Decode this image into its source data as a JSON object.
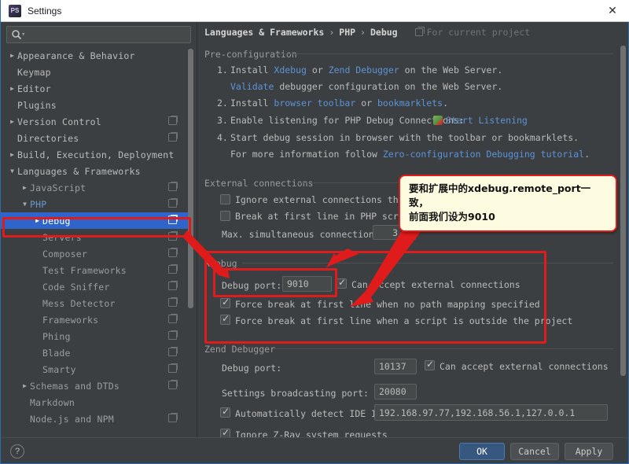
{
  "window": {
    "title": "Settings",
    "app_icon": "phpstorm-icon",
    "close_label": "✕"
  },
  "sidebar": {
    "search": {
      "placeholder": "",
      "value": "",
      "icon": "search-icon"
    },
    "items": [
      {
        "label": "Appearance & Behavior",
        "indent": 0,
        "arrow": "right",
        "copy": false,
        "selected": false,
        "style": "normal"
      },
      {
        "label": "Keymap",
        "indent": 0,
        "arrow": "none",
        "copy": false,
        "selected": false,
        "style": "normal"
      },
      {
        "label": "Editor",
        "indent": 0,
        "arrow": "right",
        "copy": false,
        "selected": false,
        "style": "normal"
      },
      {
        "label": "Plugins",
        "indent": 0,
        "arrow": "none",
        "copy": false,
        "selected": false,
        "style": "normal"
      },
      {
        "label": "Version Control",
        "indent": 0,
        "arrow": "right",
        "copy": true,
        "selected": false,
        "style": "normal"
      },
      {
        "label": "Directories",
        "indent": 0,
        "arrow": "none",
        "copy": true,
        "selected": false,
        "style": "normal"
      },
      {
        "label": "Build, Execution, Deployment",
        "indent": 0,
        "arrow": "right",
        "copy": false,
        "selected": false,
        "style": "normal"
      },
      {
        "label": "Languages & Frameworks",
        "indent": 0,
        "arrow": "down",
        "copy": false,
        "selected": false,
        "style": "normal"
      },
      {
        "label": "JavaScript",
        "indent": 1,
        "arrow": "right",
        "copy": true,
        "selected": false,
        "style": "dim"
      },
      {
        "label": "PHP",
        "indent": 1,
        "arrow": "down",
        "copy": true,
        "selected": false,
        "style": "blue"
      },
      {
        "label": "Debug",
        "indent": 2,
        "arrow": "right",
        "copy": true,
        "selected": true,
        "style": "normal"
      },
      {
        "label": "Servers",
        "indent": 2,
        "arrow": "none",
        "copy": true,
        "selected": false,
        "style": "dim"
      },
      {
        "label": "Composer",
        "indent": 2,
        "arrow": "none",
        "copy": true,
        "selected": false,
        "style": "dim"
      },
      {
        "label": "Test Frameworks",
        "indent": 2,
        "arrow": "none",
        "copy": true,
        "selected": false,
        "style": "dim"
      },
      {
        "label": "Code Sniffer",
        "indent": 2,
        "arrow": "none",
        "copy": true,
        "selected": false,
        "style": "dim"
      },
      {
        "label": "Mess Detector",
        "indent": 2,
        "arrow": "none",
        "copy": true,
        "selected": false,
        "style": "dim"
      },
      {
        "label": "Frameworks",
        "indent": 2,
        "arrow": "none",
        "copy": true,
        "selected": false,
        "style": "dim"
      },
      {
        "label": "Phing",
        "indent": 2,
        "arrow": "none",
        "copy": true,
        "selected": false,
        "style": "dim"
      },
      {
        "label": "Blade",
        "indent": 2,
        "arrow": "none",
        "copy": true,
        "selected": false,
        "style": "dim"
      },
      {
        "label": "Smarty",
        "indent": 2,
        "arrow": "none",
        "copy": true,
        "selected": false,
        "style": "dim"
      },
      {
        "label": "Schemas and DTDs",
        "indent": 1,
        "arrow": "right",
        "copy": true,
        "selected": false,
        "style": "dim"
      },
      {
        "label": "Markdown",
        "indent": 1,
        "arrow": "none",
        "copy": false,
        "selected": false,
        "style": "dim"
      },
      {
        "label": "Node.js and NPM",
        "indent": 1,
        "arrow": "none",
        "copy": true,
        "selected": false,
        "style": "dim"
      }
    ]
  },
  "main": {
    "breadcrumb": {
      "part1": "Languages & Frameworks",
      "sep1": "›",
      "part2": "PHP",
      "sep2": "›",
      "part3": "Debug",
      "project_scope": "For current project"
    },
    "pre_configuration": {
      "title": "Pre-configuration",
      "step1_num": "1.",
      "step1_a": "Install",
      "step1_link1": "Xdebug",
      "step1_b": "or",
      "step1_link2": "Zend Debugger",
      "step1_c": "on the Web Server.",
      "step1b_link": "Validate",
      "step1b_text": "debugger configuration on the Web Server.",
      "step2_num": "2.",
      "step2_a": "Install",
      "step2_link1": "browser toolbar",
      "step2_b": "or",
      "step2_link2": "bookmarklets",
      "step2_c": ".",
      "step3_num": "3.",
      "step3_a": "Enable listening for PHP Debug Connections:",
      "step3_link": "Start Listening",
      "step4_num": "4.",
      "step4_a": "Start debug session in browser with the toolbar or bookmarklets.",
      "step4b_a": "For more information follow",
      "step4b_link": "Zero-configuration Debugging tutorial",
      "step4b_b": "."
    },
    "external_connections": {
      "title": "External connections",
      "ignore_external_label": "Ignore external connections through",
      "ignore_external_checked": false,
      "break_first_line_label": "Break at first line in PHP scripts",
      "break_first_line_checked": false,
      "max_conn_label": "Max. simultaneous connections:",
      "max_conn_value": "3"
    },
    "xdebug": {
      "title": "Xdebug",
      "debug_port_label": "Debug port:",
      "debug_port_value": "9010",
      "can_accept_label": "Can accept external connections",
      "can_accept_checked": true,
      "force_break_nopath_label": "Force break at first line when no path mapping specified",
      "force_break_nopath_checked": true,
      "force_break_outside_label": "Force break at first line when a script is outside the project",
      "force_break_outside_checked": true
    },
    "zend_debugger": {
      "title": "Zend Debugger",
      "debug_port_label": "Debug port:",
      "debug_port_value": "10137",
      "can_accept_label": "Can accept external connections",
      "can_accept_checked": true,
      "broadcast_label": "Settings broadcasting port:",
      "broadcast_value": "20080",
      "autodetect_label": "Automatically detect IDE IP:",
      "autodetect_checked": true,
      "autodetect_value": "192.168.97.77,192.168.56.1,127.0.0.1",
      "ignore_zray_label": "Ignore Z-Ray system requests",
      "ignore_zray_checked": true
    }
  },
  "footer": {
    "help_label": "?",
    "ok_label": "OK",
    "cancel_label": "Cancel",
    "apply_label": "Apply"
  },
  "annotation": {
    "tooltip_line1": "要和扩展中的xdebug.remote_port一致，",
    "tooltip_line2": "前面我们设为9010",
    "highlight_color": "#e01b1b",
    "tooltip_bg": "#fdfbe0"
  }
}
